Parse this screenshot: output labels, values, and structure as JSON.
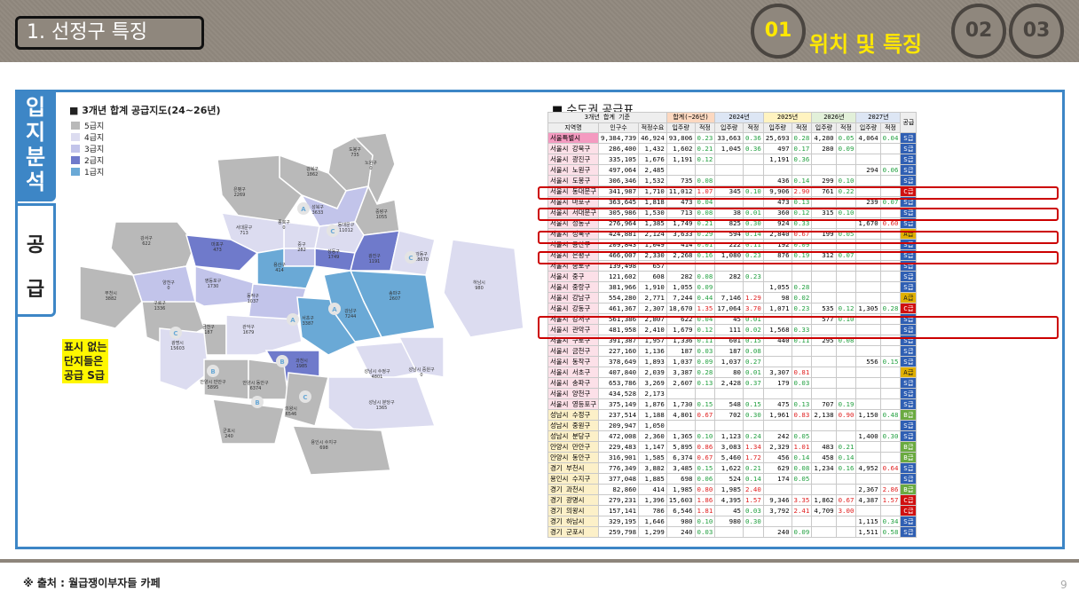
{
  "header": {
    "title": "1. 선정구 특징",
    "steps": [
      "01",
      "02",
      "03"
    ],
    "active_step_label": "위치 및 특징"
  },
  "side_tabs": {
    "tab1": [
      "입",
      "지",
      "분",
      "석"
    ],
    "tab2": [
      "공",
      "급"
    ]
  },
  "map": {
    "title": "■ 3개년 합계 공급지도(24~26년)",
    "legend": [
      {
        "label": "5급지",
        "color": "#b9b9b9"
      },
      {
        "label": "4급지",
        "color": "#dcdcf0"
      },
      {
        "label": "3급지",
        "color": "#c2c4ea"
      },
      {
        "label": "2급지",
        "color": "#6f7acb"
      },
      {
        "label": "1급지",
        "color": "#6aa9d6"
      }
    ],
    "note_lines": [
      "표시 없는",
      "단지들은",
      "공급 S급"
    ],
    "districts": [
      {
        "name": "도봉구",
        "value": "735"
      },
      {
        "name": "노원구",
        "value": "0"
      },
      {
        "name": "강북구",
        "value": "1862"
      },
      {
        "name": "은평구",
        "value": "2269"
      },
      {
        "name": "성북구",
        "value": "3633"
      },
      {
        "name": "중랑구",
        "value": "1055"
      },
      {
        "name": "종로구",
        "value": "0"
      },
      {
        "name": "동대문구",
        "value": "11012"
      },
      {
        "name": "서대문구",
        "value": "713"
      },
      {
        "name": "강서구",
        "value": "622"
      },
      {
        "name": "마포구",
        "value": "473"
      },
      {
        "name": "중구",
        "value": "282"
      },
      {
        "name": "성동구",
        "value": "1749"
      },
      {
        "name": "광진구",
        "value": "1191"
      },
      {
        "name": "강동구",
        "value": "18670"
      },
      {
        "name": "용산구",
        "value": "414"
      },
      {
        "name": "하남시",
        "value": "980"
      },
      {
        "name": "부천시",
        "value": "3882"
      },
      {
        "name": "양천구",
        "value": "0"
      },
      {
        "name": "영등포구",
        "value": "1730"
      },
      {
        "name": "동작구",
        "value": "1037"
      },
      {
        "name": "송파구",
        "value": "2607"
      },
      {
        "name": "구로구",
        "value": "1336"
      },
      {
        "name": "서초구",
        "value": "3387"
      },
      {
        "name": "강남구",
        "value": "7244"
      },
      {
        "name": "금천구",
        "value": "187"
      },
      {
        "name": "관악구",
        "value": "1679"
      },
      {
        "name": "광명시",
        "value": "15603"
      },
      {
        "name": "과천시",
        "value": "1985"
      },
      {
        "name": "성남시 수정구",
        "value": "4801"
      },
      {
        "name": "성남시 중원구",
        "value": "0"
      },
      {
        "name": "안양시 만안구",
        "value": "5895"
      },
      {
        "name": "안양시 동안구",
        "value": "6374"
      },
      {
        "name": "의왕시",
        "value": "6546"
      },
      {
        "name": "성남시 분당구",
        "value": "1365"
      },
      {
        "name": "군포시",
        "value": "240"
      },
      {
        "name": "용인시 수지구",
        "value": "698"
      }
    ]
  },
  "table": {
    "title": "■ 수도권 공급표",
    "header_top": [
      "3개년 합계 기준",
      "합계(~26년)",
      "2024년",
      "2025년",
      "2026년",
      "2027년",
      "공급"
    ],
    "header_sub": [
      "지역명",
      "인구수",
      "적정수요",
      "입주량",
      "적정",
      "입주량",
      "적정",
      "입주량",
      "적정",
      "입주량",
      "적정",
      "입주량",
      "적정"
    ],
    "rows": [
      [
        "서울특별시",
        "9,384,739",
        "46,924",
        "93,806",
        "0.23",
        "33,663",
        "0.36",
        "25,693",
        "0.28",
        "4,280",
        "0.05",
        "4,064",
        "0.04",
        "S급"
      ],
      [
        "서울시 강북구",
        "286,400",
        "1,432",
        "1,602",
        "0.21",
        "1,045",
        "0.36",
        "497",
        "0.17",
        "280",
        "0.09",
        "",
        "",
        "S급"
      ],
      [
        "서울시 광진구",
        "335,105",
        "1,676",
        "1,191",
        "0.12",
        "",
        "",
        "1,191",
        "0.36",
        "",
        "",
        "",
        "",
        "S급"
      ],
      [
        "서울시 노원구",
        "497,064",
        "2,485",
        "",
        "",
        "",
        "",
        "",
        "",
        "",
        "",
        "294",
        "0.06",
        "S급"
      ],
      [
        "서울시 도봉구",
        "306,346",
        "1,532",
        "735",
        "0.08",
        "",
        "",
        "436",
        "0.14",
        "299",
        "0.10",
        "",
        "",
        "S급"
      ],
      [
        "서울시 동대문구",
        "341,987",
        "1,710",
        "11,012",
        "1.07",
        "345",
        "0.10",
        "9,906",
        "2.90",
        "761",
        "0.22",
        "",
        "",
        "C급"
      ],
      [
        "서울시 마포구",
        "363,645",
        "1,818",
        "473",
        "0.04",
        "",
        "",
        "473",
        "0.13",
        "",
        "",
        "239",
        "0.07",
        "S급"
      ],
      [
        "서울시 서대문구",
        "305,986",
        "1,530",
        "713",
        "0.08",
        "38",
        "0.01",
        "360",
        "0.12",
        "315",
        "0.10",
        "",
        "",
        "S급"
      ],
      [
        "서울시 성동구",
        "276,964",
        "1,385",
        "1,749",
        "0.21",
        "825",
        "0.30",
        "924",
        "0.33",
        "",
        "",
        "1,670",
        "0.60",
        "S급"
      ],
      [
        "서울시 성북구",
        "424,881",
        "2,124",
        "3,633",
        "0.29",
        "594",
        "0.14",
        "2,840",
        "0.67",
        "199",
        "0.05",
        "",
        "",
        "A급"
      ],
      [
        "서울시 용산구",
        "209,843",
        "1,049",
        "414",
        "0.01",
        "222",
        "0.11",
        "192",
        "0.09",
        "",
        "",
        "",
        "",
        "S급"
      ],
      [
        "서울시 은평구",
        "466,007",
        "2,330",
        "2,268",
        "0.16",
        "1,080",
        "0.23",
        "876",
        "0.19",
        "312",
        "0.07",
        "",
        "",
        "S급"
      ],
      [
        "서울시 종로구",
        "139,498",
        "657",
        "",
        "",
        "",
        "",
        "",
        "",
        "",
        "",
        "",
        "",
        "S급"
      ],
      [
        "서울시 중구",
        "121,602",
        "608",
        "282",
        "0.08",
        "282",
        "0.23",
        "",
        "",
        "",
        "",
        "",
        "",
        "S급"
      ],
      [
        "서울시 중랑구",
        "381,966",
        "1,910",
        "1,055",
        "0.09",
        "",
        "",
        "1,055",
        "0.28",
        "",
        "",
        "",
        "",
        "S급"
      ],
      [
        "서울시 강남구",
        "554,280",
        "2,771",
        "7,244",
        "0.44",
        "7,146",
        "1.29",
        "98",
        "0.02",
        "",
        "",
        "",
        "",
        "A급"
      ],
      [
        "서울시 강동구",
        "461,367",
        "2,307",
        "18,670",
        "1.35",
        "17,064",
        "3.70",
        "1,071",
        "0.23",
        "535",
        "0.12",
        "1,305",
        "0.28",
        "C급"
      ],
      [
        "서울시 강서구",
        "561,386",
        "2,807",
        "622",
        "0.04",
        "45",
        "0.01",
        "",
        "",
        "577",
        "0.10",
        "",
        "",
        "S급"
      ],
      [
        "서울시 관악구",
        "481,958",
        "2,410",
        "1,679",
        "0.12",
        "111",
        "0.02",
        "1,568",
        "0.33",
        "",
        "",
        "",
        "",
        "S급"
      ],
      [
        "서울시 구로구",
        "391,387",
        "1,957",
        "1,336",
        "0.11",
        "601",
        "0.15",
        "440",
        "0.11",
        "295",
        "0.08",
        "",
        "",
        "S급"
      ],
      [
        "서울시 금천구",
        "227,160",
        "1,136",
        "187",
        "0.03",
        "187",
        "0.08",
        "",
        "",
        "",
        "",
        "",
        "",
        "S급"
      ],
      [
        "서울시 동작구",
        "378,649",
        "1,893",
        "1,037",
        "0.09",
        "1,037",
        "0.27",
        "",
        "",
        "",
        "",
        "556",
        "0.15",
        "S급"
      ],
      [
        "서울시 서초구",
        "407,840",
        "2,039",
        "3,387",
        "0.28",
        "80",
        "0.01",
        "3,307",
        "0.81",
        "",
        "",
        "",
        "",
        "A급"
      ],
      [
        "서울시 송파구",
        "653,786",
        "3,269",
        "2,607",
        "0.13",
        "2,428",
        "0.37",
        "179",
        "0.03",
        "",
        "",
        "",
        "",
        "S급"
      ],
      [
        "서울시 양천구",
        "434,528",
        "2,173",
        "",
        "",
        "",
        "",
        "",
        "",
        "",
        "",
        "",
        "",
        "S급"
      ],
      [
        "서울시 영등포구",
        "375,149",
        "1,876",
        "1,730",
        "0.15",
        "548",
        "0.15",
        "475",
        "0.13",
        "707",
        "0.19",
        "",
        "",
        "S급"
      ],
      [
        "성남시 수정구",
        "237,514",
        "1,188",
        "4,801",
        "0.67",
        "702",
        "0.30",
        "1,961",
        "0.83",
        "2,138",
        "0.90",
        "1,150",
        "0.48",
        "B급"
      ],
      [
        "성남시 중원구",
        "209,947",
        "1,050",
        "",
        "",
        "",
        "",
        "",
        "",
        "",
        "",
        "",
        "",
        "S급"
      ],
      [
        "성남시 분당구",
        "472,008",
        "2,360",
        "1,365",
        "0.10",
        "1,123",
        "0.24",
        "242",
        "0.05",
        "",
        "",
        "1,400",
        "0.30",
        "S급"
      ],
      [
        "안양시 만안구",
        "229,483",
        "1,147",
        "5,895",
        "0.86",
        "3,083",
        "1.34",
        "2,329",
        "1.01",
        "483",
        "0.21",
        "",
        "",
        "B급"
      ],
      [
        "안양시 동안구",
        "316,901",
        "1,585",
        "6,374",
        "0.67",
        "5,460",
        "1.72",
        "456",
        "0.14",
        "458",
        "0.14",
        "",
        "",
        "B급"
      ],
      [
        "경기 부천시",
        "776,349",
        "3,882",
        "3,485",
        "0.15",
        "1,622",
        "0.21",
        "629",
        "0.08",
        "1,234",
        "0.16",
        "4,952",
        "0.64",
        "S급"
      ],
      [
        "용인시 수지구",
        "377,048",
        "1,885",
        "698",
        "0.06",
        "524",
        "0.14",
        "174",
        "0.05",
        "",
        "",
        "",
        "",
        "S급"
      ],
      [
        "경기 과천시",
        "82,860",
        "414",
        "1,985",
        "0.80",
        "1,985",
        "2.40",
        "",
        "",
        "",
        "",
        "2,367",
        "2.86",
        "B급"
      ],
      [
        "경기 광명시",
        "279,231",
        "1,396",
        "15,603",
        "1.86",
        "4,395",
        "1.57",
        "9,346",
        "3.35",
        "1,862",
        "0.67",
        "4,387",
        "1.57",
        "C급"
      ],
      [
        "경기 의왕시",
        "157,141",
        "786",
        "6,546",
        "1.81",
        "45",
        "0.03",
        "3,792",
        "2.41",
        "4,709",
        "3.00",
        "",
        "",
        "C급"
      ],
      [
        "경기 하남시",
        "329,195",
        "1,646",
        "980",
        "0.10",
        "980",
        "0.30",
        "",
        "",
        "",
        "",
        "1,115",
        "0.34",
        "S급"
      ],
      [
        "경기 군포시",
        "259,798",
        "1,299",
        "240",
        "0.03",
        "",
        "",
        "240",
        "0.09",
        "",
        "",
        "1,511",
        "0.58",
        "S급"
      ]
    ]
  },
  "footer": {
    "source": "※ 출처 : 월급쟁이부자들 카페",
    "page": "9"
  }
}
